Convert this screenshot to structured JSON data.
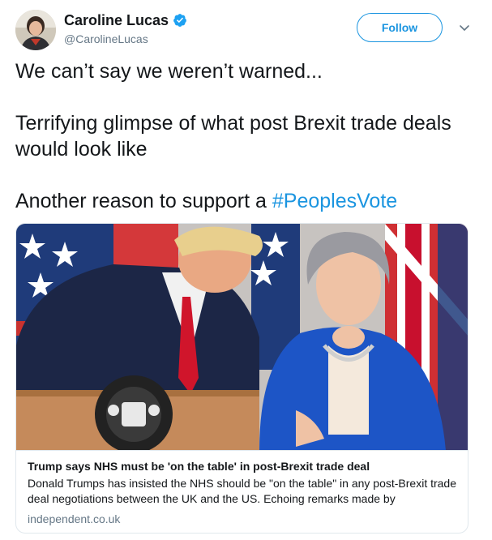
{
  "author": {
    "display_name": "Caroline Lucas",
    "handle": "@CarolineLucas",
    "verified": true,
    "avatar_icon": "profile-photo"
  },
  "actions": {
    "follow_label": "Follow",
    "menu_icon": "chevron-down-icon"
  },
  "tweet": {
    "line1": "We can’t say we weren’t warned...",
    "line2": "Terrifying glimpse of what post Brexit trade deals would look like",
    "line3_prefix": "Another reason to support a ",
    "hashtag": "#PeoplesVote"
  },
  "card": {
    "image_alt_icon": "news-photo",
    "title": "Trump says NHS must be 'on the table' in post-Brexit trade deal",
    "description": "Donald Trumps has insisted the NHS should be \"on the table\" in any post-Brexit trade deal negotiations between the UK and the US.  Echoing remarks made by",
    "domain": "independent.co.uk"
  },
  "colors": {
    "brand_blue": "#1b95e0",
    "text": "#14171a",
    "secondary": "#657786",
    "border": "#e1e8ed"
  }
}
